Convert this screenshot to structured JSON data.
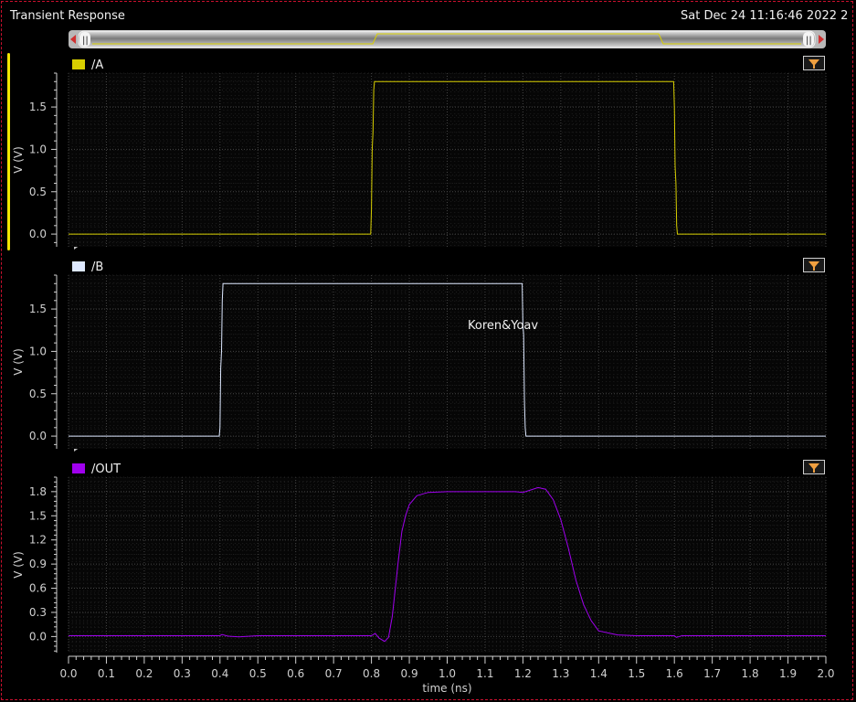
{
  "window": {
    "title": "Transient Response",
    "timestamp": "Sat Dec 24 11:16:46 2022  2"
  },
  "annotation": "Koren&Yoav",
  "colors": {
    "A": "#d8cf00",
    "B": "#dde8ff",
    "OUT": "#a000ee",
    "grid": "#3a3a3a",
    "axis": "#d0d0d0",
    "frame": "#c8102e"
  },
  "chart_data": [
    {
      "type": "line",
      "legend": "/A",
      "ylabel": "V (V)",
      "ylim": [
        -0.15,
        1.9
      ],
      "yticks": [
        0.0,
        0.5,
        1.0,
        1.5
      ],
      "ytick_labels": [
        "0.0",
        "0.5",
        "1.0",
        "1.5"
      ],
      "series": [
        {
          "name": "/A",
          "x": [
            0.0,
            0.798,
            0.8,
            0.802,
            0.804,
            0.806,
            0.808,
            1.598,
            1.6,
            1.602,
            1.604,
            1.606,
            1.608,
            2.0
          ],
          "y": [
            0.0,
            0.0,
            0.3,
            1.0,
            1.2,
            1.7,
            1.8,
            1.8,
            1.5,
            0.8,
            0.6,
            0.1,
            0.0,
            0.0
          ]
        }
      ]
    },
    {
      "type": "line",
      "legend": "/B",
      "ylabel": "V (V)",
      "ylim": [
        -0.15,
        1.9
      ],
      "yticks": [
        0.0,
        0.5,
        1.0,
        1.5
      ],
      "ytick_labels": [
        "0.0",
        "0.5",
        "1.0",
        "1.5"
      ],
      "series": [
        {
          "name": "/B",
          "x": [
            0.0,
            0.398,
            0.4,
            0.402,
            0.404,
            0.406,
            0.408,
            1.198,
            1.2,
            1.202,
            1.204,
            1.206,
            1.208,
            2.0
          ],
          "y": [
            0.0,
            0.0,
            0.1,
            0.8,
            1.0,
            1.6,
            1.8,
            1.8,
            1.3,
            1.2,
            0.4,
            0.1,
            0.0,
            0.0
          ]
        }
      ]
    },
    {
      "type": "line",
      "legend": "/OUT",
      "ylabel": "V (V)",
      "xlabel": "time (ns)",
      "ylim": [
        -0.2,
        1.98
      ],
      "xlim": [
        0.0,
        2.0
      ],
      "yticks": [
        0.0,
        0.3,
        0.6,
        0.9,
        1.2,
        1.5,
        1.8
      ],
      "ytick_labels": [
        "0.0",
        "0.3",
        "0.6",
        "0.9",
        "1.2",
        "1.5",
        "1.8"
      ],
      "xticks": [
        0.0,
        0.1,
        0.2,
        0.3,
        0.4,
        0.5,
        0.6,
        0.7,
        0.8,
        0.9,
        1.0,
        1.1,
        1.2,
        1.3,
        1.4,
        1.5,
        1.6,
        1.7,
        1.8,
        1.9,
        2.0
      ],
      "xtick_labels": [
        "0.0",
        "0.1",
        "0.2",
        "0.3",
        "0.4",
        "0.5",
        "0.6",
        "0.7",
        "0.8",
        "0.9",
        "1.0",
        "1.1",
        "1.2",
        "1.3",
        "1.4",
        "1.5",
        "1.6",
        "1.7",
        "1.8",
        "1.9",
        "2.0"
      ],
      "series": [
        {
          "name": "/OUT",
          "x": [
            0.0,
            0.4,
            0.405,
            0.42,
            0.45,
            0.5,
            0.8,
            0.81,
            0.82,
            0.835,
            0.845,
            0.855,
            0.87,
            0.88,
            0.89,
            0.9,
            0.92,
            0.95,
            1.0,
            1.1,
            1.18,
            1.2,
            1.22,
            1.24,
            1.26,
            1.28,
            1.3,
            1.32,
            1.34,
            1.36,
            1.38,
            1.4,
            1.45,
            1.5,
            1.6,
            1.605,
            1.62,
            1.7,
            2.0
          ],
          "y": [
            0.01,
            0.01,
            0.025,
            0.005,
            -0.005,
            0.01,
            0.01,
            0.04,
            -0.02,
            -0.06,
            -0.01,
            0.25,
            0.9,
            1.3,
            1.5,
            1.64,
            1.75,
            1.79,
            1.8,
            1.8,
            1.8,
            1.79,
            1.82,
            1.85,
            1.83,
            1.7,
            1.45,
            1.1,
            0.7,
            0.4,
            0.2,
            0.07,
            0.02,
            0.01,
            0.01,
            -0.01,
            0.01,
            0.01,
            0.01
          ]
        }
      ]
    }
  ]
}
